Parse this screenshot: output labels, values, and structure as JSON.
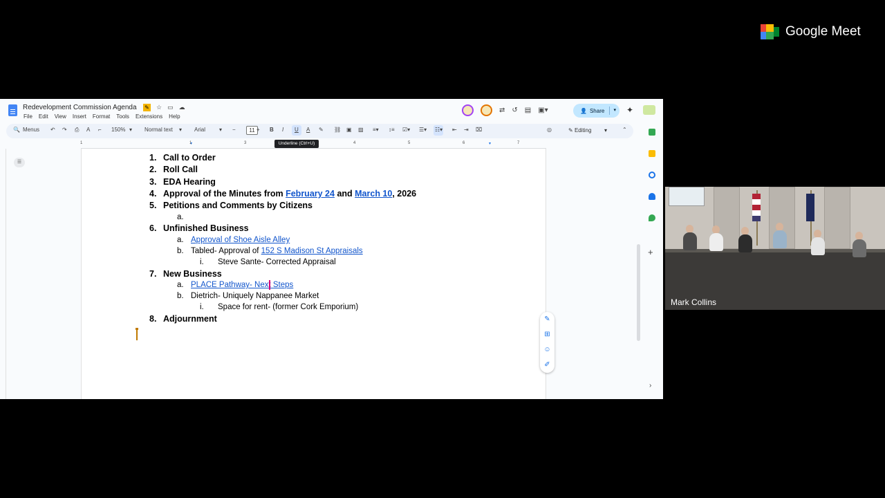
{
  "meet": {
    "brand": "Google Meet",
    "participant_name": "Mark Collins"
  },
  "doc": {
    "title": "Redevelopment Commission Agenda",
    "menu": [
      "File",
      "Edit",
      "View",
      "Insert",
      "Format",
      "Tools",
      "Extensions",
      "Help"
    ],
    "share_label": "Share",
    "toolbar": {
      "menus": "Menus",
      "zoom": "150%",
      "style": "Normal text",
      "font": "Arial",
      "font_size": "11",
      "bold": "B",
      "italic": "I",
      "underline": "U",
      "text_color": "A",
      "editing": "Editing"
    },
    "tooltip": "Underline (Ctrl+U)",
    "ruler_marks": [
      "1",
      "1",
      "2",
      "3",
      "4",
      "5",
      "6",
      "7"
    ],
    "agenda": [
      {
        "num": "1.",
        "text": "Call to Order"
      },
      {
        "num": "2.",
        "text": "Roll Call"
      },
      {
        "num": "3.",
        "text": "EDA Hearing"
      },
      {
        "num": "4.",
        "pre": "Approval of the Minutes from ",
        "link1": "February 24",
        "mid": " and ",
        "link2": "March 10",
        "post": ", 2026"
      },
      {
        "num": "5.",
        "text": "Petitions and Comments by Citizens"
      },
      {
        "num": "a.",
        "text": ""
      },
      {
        "num": "6.",
        "text": "Unfinished Business"
      },
      {
        "num": "a.",
        "link": "Approval of Shoe Aisle Alley"
      },
      {
        "num": "b.",
        "pre": "Tabled- Approval of ",
        "link": "152 S Madison St Appraisals"
      },
      {
        "num": "i.",
        "text": "Steve Sante- Corrected Appraisal"
      },
      {
        "num": "7.",
        "text": "New Business"
      },
      {
        "num": "a.",
        "link": "PLACE Pathway- Next Steps"
      },
      {
        "num": "b.",
        "text": "Dietrich- Uniquely Nappanee Market"
      },
      {
        "num": "i.",
        "text": "Space for rent- (former Cork Emporium)"
      },
      {
        "num": "8.",
        "text": "Adjournment"
      }
    ]
  }
}
